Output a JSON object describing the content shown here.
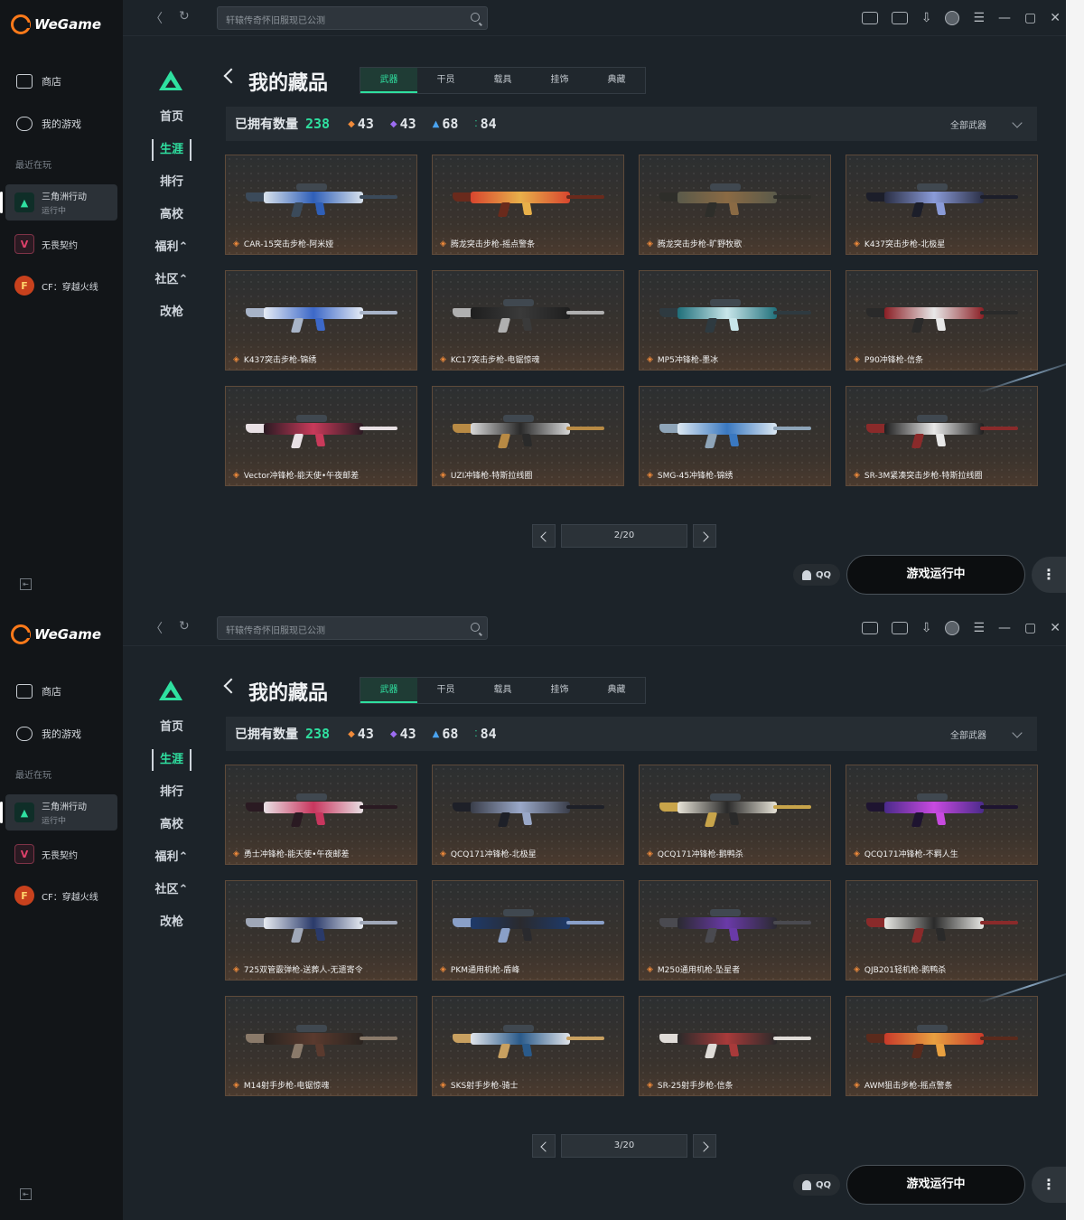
{
  "app": {
    "brand": "WeGame",
    "nav": [
      {
        "label": "商店",
        "icon": "bag-icon"
      },
      {
        "label": "我的游戏",
        "icon": "gamepad-icon"
      }
    ],
    "recent_label": "最近在玩",
    "recent_games": [
      {
        "title": "三角洲行动",
        "status": "运行中",
        "icon": "delta-force-icon",
        "active": true
      },
      {
        "title": "无畏契约",
        "status": "",
        "icon": "valorant-icon",
        "active": false
      },
      {
        "title": "CF：穿越火线",
        "status": "",
        "icon": "crossfire-icon",
        "active": false
      }
    ],
    "search_placeholder": "轩辕传奇怀旧服现已公测"
  },
  "game_nav": {
    "items": [
      "首页",
      "生涯",
      "排行",
      "高校",
      "福利⌃",
      "社区⌃",
      "改枪"
    ],
    "active_index": 1
  },
  "collection": {
    "title": "我的藏品",
    "tabs": [
      "武器",
      "干员",
      "载具",
      "挂饰",
      "典藏"
    ],
    "active_tab": 0,
    "owned_label": "已拥有数量",
    "owned_count": "238",
    "rarity_counts": [
      {
        "value": "43",
        "color": "#f08a3a",
        "icon": "diamond-orange-icon"
      },
      {
        "value": "43",
        "color": "#9b6cf0",
        "icon": "diamond-purple-icon"
      },
      {
        "value": "68",
        "color": "#4aa3f0",
        "icon": "chevron-blue-icon"
      },
      {
        "value": "84",
        "color": "#2fe0a0",
        "icon": "dots-green-icon"
      }
    ],
    "filter_label": "全部武器"
  },
  "pages": [
    {
      "page": "2/20",
      "items": [
        {
          "name": "CAR-15突击步枪-阿米娅",
          "colors": [
            "#d9e2ec",
            "#2f5fb8",
            "#3b4a5a"
          ]
        },
        {
          "name": "腾龙突击步枪-摇点警条",
          "colors": [
            "#d8452e",
            "#e8b04a",
            "#6a2a1c"
          ]
        },
        {
          "name": "腾龙突击步枪-旷野牧歌",
          "colors": [
            "#5a5a4a",
            "#8a6a44",
            "#2e2e2a"
          ]
        },
        {
          "name": "K437突击步枪-北极星",
          "colors": [
            "#2a2e44",
            "#8a9bd8",
            "#1c1e2a"
          ]
        },
        {
          "name": "K437突击步枪-锦绣",
          "colors": [
            "#e6ecf5",
            "#3c68c8",
            "#a8b4c8"
          ]
        },
        {
          "name": "KC17突击步枪-电锯惊魂",
          "colors": [
            "#1e1e1e",
            "#3a3a3a",
            "#b0b0b0"
          ]
        },
        {
          "name": "MP5冲锋枪-墨冰",
          "colors": [
            "#1f6f7a",
            "#c8e6ea",
            "#2e3a40"
          ]
        },
        {
          "name": "P90冲锋枪-信条",
          "colors": [
            "#8a1e24",
            "#e8e8e8",
            "#2a2a2a"
          ]
        },
        {
          "name": "Vector冲锋枪-能天使•午夜邮差",
          "colors": [
            "#2a1a22",
            "#c83a5a",
            "#e8e0e4"
          ]
        },
        {
          "name": "UZI冲锋枪-特斯拉线圈",
          "colors": [
            "#d8d8d8",
            "#2a2a2a",
            "#b88a44"
          ]
        },
        {
          "name": "SMG-45冲锋枪-锦绣",
          "colors": [
            "#dce8f2",
            "#3a78c0",
            "#8ea4b8"
          ]
        },
        {
          "name": "SR-3M紧凑突击步枪-特斯拉线圈",
          "colors": [
            "#1e1e1e",
            "#e8e8e8",
            "#8a2a2a"
          ]
        }
      ]
    },
    {
      "page": "3/20",
      "items": [
        {
          "name": "勇士冲锋枪-能天使•午夜邮差",
          "colors": [
            "#e8e0e4",
            "#c8365e",
            "#2a1a22"
          ]
        },
        {
          "name": "QCQ171冲锋枪-北极星",
          "colors": [
            "#3a3e4a",
            "#9aa8c8",
            "#1e2028"
          ]
        },
        {
          "name": "QCQ171冲锋枪-鹅鸭杀",
          "colors": [
            "#e8e4d8",
            "#2a2a2a",
            "#c8a44a"
          ]
        },
        {
          "name": "QCQ171冲锋枪-不羁人生",
          "colors": [
            "#4a2a8a",
            "#c84ae0",
            "#1e1430"
          ]
        },
        {
          "name": "725双管霰弹枪-送葬人-无遗寄令",
          "colors": [
            "#e8ecf2",
            "#2a3a6a",
            "#a0a8b8"
          ]
        },
        {
          "name": "PKM通用机枪-盾峰",
          "colors": [
            "#1e3a6a",
            "#2a2a2e",
            "#8aa0c8"
          ]
        },
        {
          "name": "M250通用机枪-坠星者",
          "colors": [
            "#2a2a30",
            "#6a3aa8",
            "#4a4a50"
          ]
        },
        {
          "name": "QJB201轻机枪-鹅鸭杀",
          "colors": [
            "#e8e8e4",
            "#2a2a2a",
            "#8a2a2a"
          ]
        },
        {
          "name": "M14射手步枪-电锯惊魂",
          "colors": [
            "#2a2420",
            "#5a3a2e",
            "#8a7a6a"
          ]
        },
        {
          "name": "SKS射手步枪-骑士",
          "colors": [
            "#e0e4ea",
            "#2a5a8a",
            "#c8a060"
          ]
        },
        {
          "name": "SR-25射手步枪-信条",
          "colors": [
            "#2a2a2a",
            "#a83a3a",
            "#e0dcd8"
          ]
        },
        {
          "name": "AWM狙击步枪-摇点警条",
          "colors": [
            "#c83a2a",
            "#e8a040",
            "#5a2a1c"
          ]
        }
      ]
    }
  ],
  "bottom": {
    "qq_label": "QQ",
    "launch_label": "游戏运行中",
    "more_label": "⋮"
  }
}
